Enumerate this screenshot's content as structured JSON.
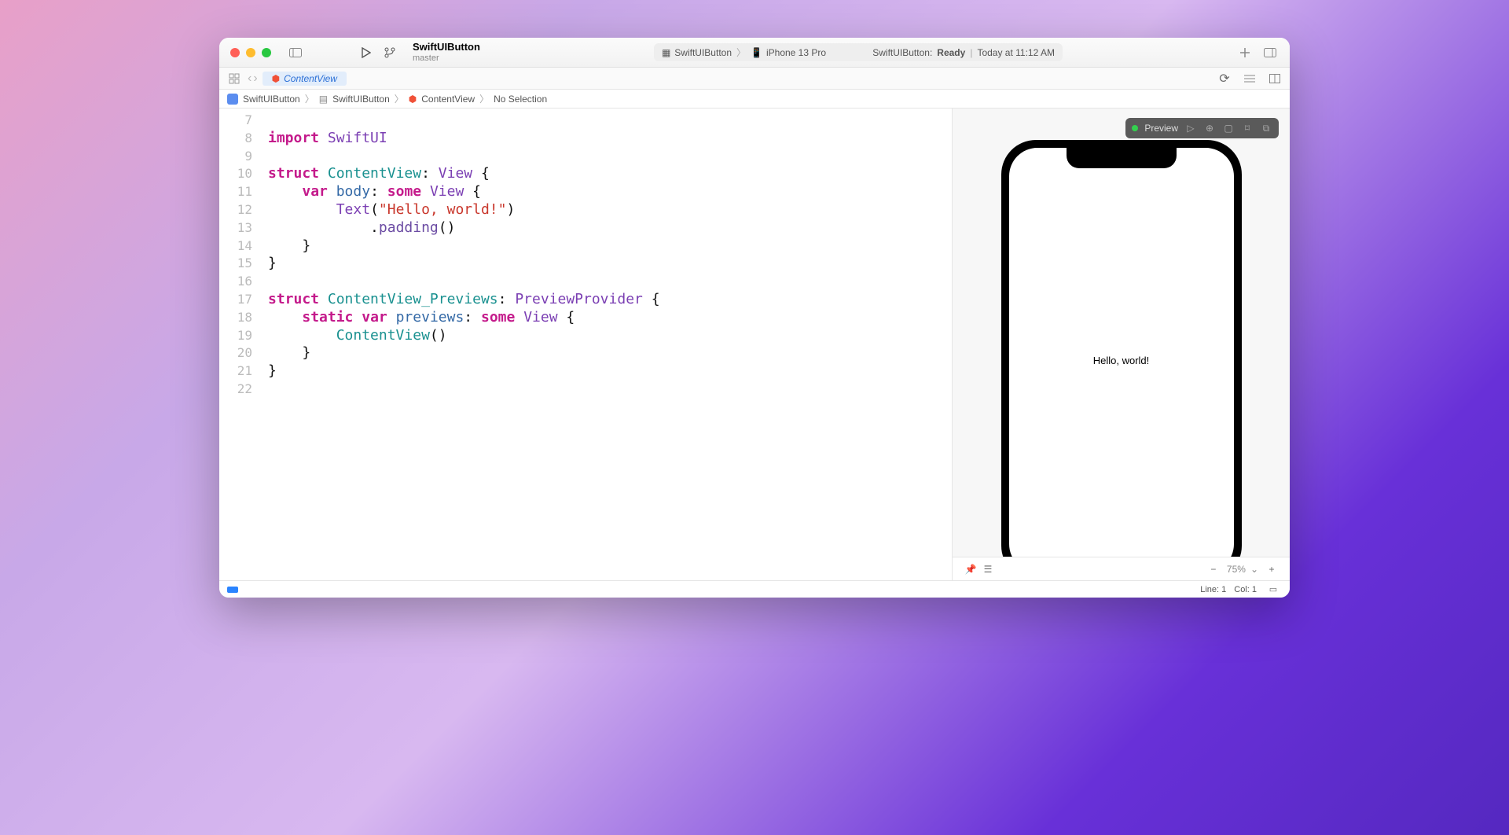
{
  "titlebar": {
    "project_name": "SwiftUIButton",
    "branch": "master",
    "scheme": "SwiftUIButton",
    "device": "iPhone 13 Pro",
    "status_project": "SwiftUIButton:",
    "status_state": "Ready",
    "status_time": "Today at 11:12 AM"
  },
  "tabs": {
    "active": "ContentView"
  },
  "breadcrumb": {
    "items": [
      "SwiftUIButton",
      "SwiftUIButton",
      "ContentView",
      "No Selection"
    ]
  },
  "editor": {
    "first_line": 7,
    "lines": [
      {
        "n": 7,
        "raw": ""
      },
      {
        "n": 8,
        "raw": "import SwiftUI"
      },
      {
        "n": 9,
        "raw": ""
      },
      {
        "n": 10,
        "raw": "struct ContentView: View {"
      },
      {
        "n": 11,
        "raw": "    var body: some View {"
      },
      {
        "n": 12,
        "raw": "        Text(\"Hello, world!\")"
      },
      {
        "n": 13,
        "raw": "            .padding()"
      },
      {
        "n": 14,
        "raw": "    }"
      },
      {
        "n": 15,
        "raw": "}"
      },
      {
        "n": 16,
        "raw": ""
      },
      {
        "n": 17,
        "raw": "struct ContentView_Previews: PreviewProvider {"
      },
      {
        "n": 18,
        "raw": "    static var previews: some View {"
      },
      {
        "n": 19,
        "raw": "        ContentView()"
      },
      {
        "n": 20,
        "raw": "    }"
      },
      {
        "n": 21,
        "raw": "}"
      },
      {
        "n": 22,
        "raw": ""
      }
    ]
  },
  "preview": {
    "label": "Preview",
    "canvas_text": "Hello, world!",
    "zoom": "75%"
  },
  "statusbar": {
    "line": "Line: 1",
    "col": "Col: 1"
  }
}
